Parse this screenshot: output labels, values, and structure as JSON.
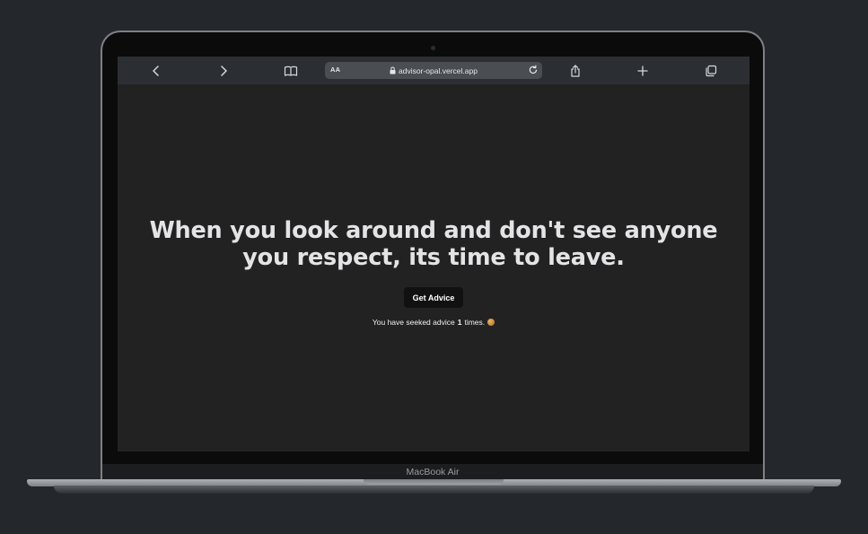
{
  "browser": {
    "url": "advisor-opal.vercel.app",
    "text_size_label": "AA"
  },
  "page": {
    "advice": "When you look around and don't see anyone you respect, its time to leave.",
    "button_label": "Get Advice",
    "count_prefix": "You have seeked advice",
    "count": "1",
    "count_suffix": "times."
  },
  "device": {
    "model": "MacBook Air"
  },
  "colors": {
    "background": "#24282c",
    "page_background": "#222222",
    "button_background": "#111111",
    "heading_text": "#e4e4e6"
  },
  "icons": [
    "back-icon",
    "forward-icon",
    "bookmarks-icon",
    "lock-icon",
    "reload-icon",
    "share-icon",
    "new-tab-icon",
    "tabs-icon",
    "cookie-emoji"
  ]
}
